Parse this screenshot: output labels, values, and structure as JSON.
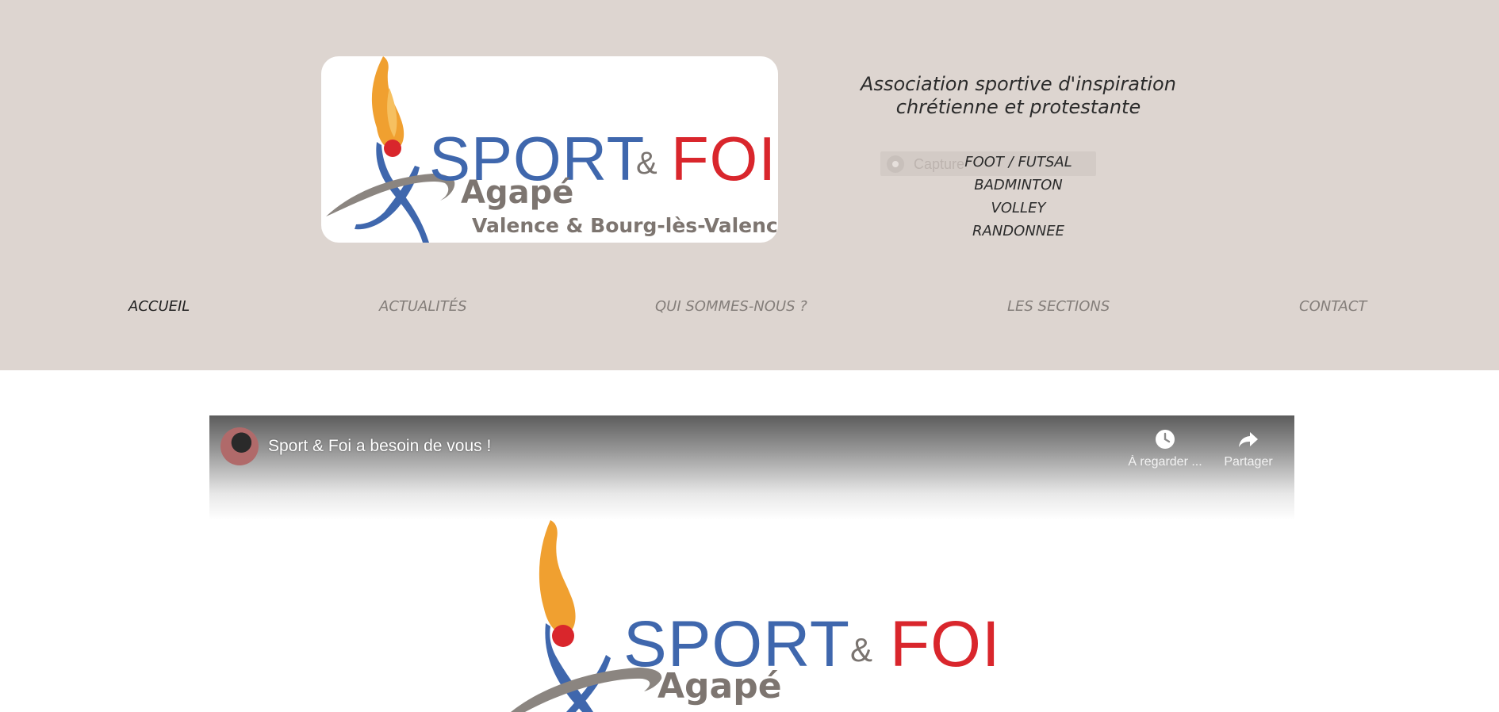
{
  "header": {
    "background": "#ddd5d0",
    "logo": {
      "word_sport": "SPORT",
      "word_amp": "&",
      "word_foi": "FOI",
      "word_agape": "Agapé",
      "city": "Valence & Bourg-lès-Valence",
      "colors": {
        "sport": "#3f67ad",
        "foi": "#d9262c",
        "flame": "#f0a030",
        "grey": "#7d7570"
      }
    },
    "tagline_line1": "Association sportive d'inspiration",
    "tagline_line2": "chrétienne et protestante",
    "capture_widget_label": "Capture",
    "sections": [
      "FOOT / FUTSAL",
      "BADMINTON",
      "VOLLEY",
      "RANDONNEE"
    ]
  },
  "nav": {
    "items": [
      {
        "label": "ACCUEIL",
        "active": true
      },
      {
        "label": "ACTUALITÉS",
        "active": false
      },
      {
        "label": "QUI SOMMES-NOUS ?",
        "active": false
      },
      {
        "label": "LES SECTIONS",
        "active": false
      },
      {
        "label": "CONTACT",
        "active": false
      }
    ]
  },
  "video": {
    "title": "Sport & Foi a besoin de vous !",
    "watch_later_label": "À regarder ...",
    "share_label": "Partager",
    "logo": {
      "word_sport": "SPORT",
      "word_amp": "&",
      "word_foi": "FOI",
      "word_agape": "Agapé"
    }
  }
}
